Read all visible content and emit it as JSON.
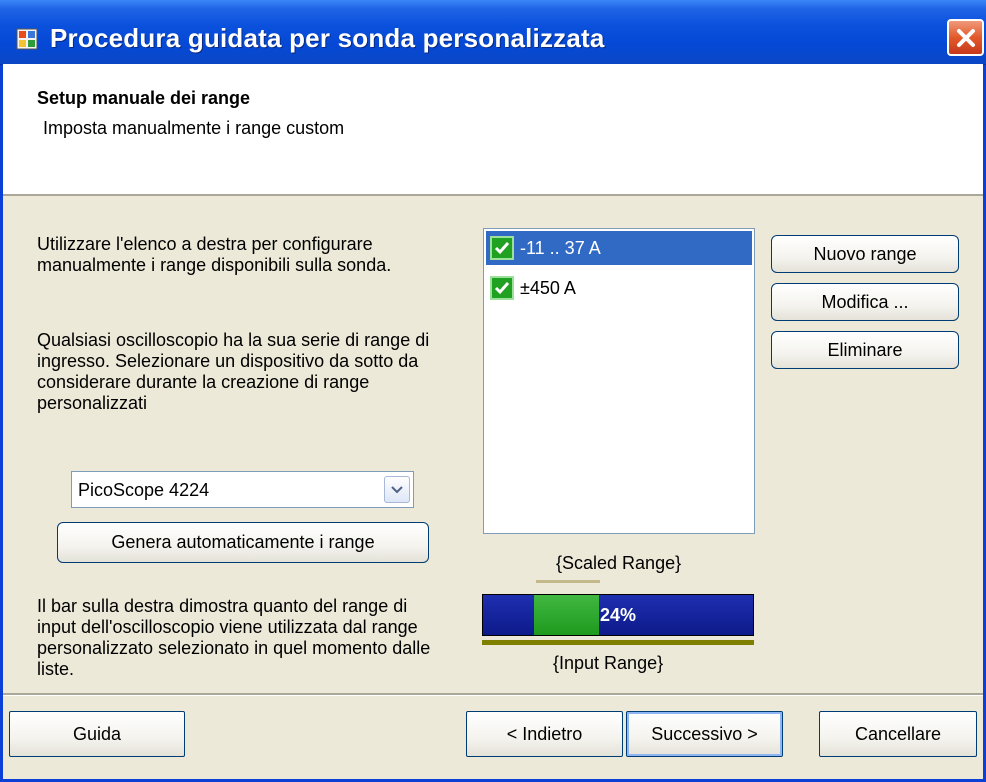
{
  "window": {
    "title": "Procedura guidata per sonda personalizzata"
  },
  "header": {
    "title": "Setup manuale dei range",
    "subtitle": "Imposta manualmente i range custom"
  },
  "instructions": {
    "para1": "Utilizzare l'elenco a destra per configurare manualmente i range disponibili sulla sonda.",
    "para2": "Qualsiasi oscilloscopio ha la sua serie di range di ingresso. Selezionare un dispositivo da sotto da considerare durante la creazione di range personalizzati",
    "para3": "Il bar sulla destra dimostra quanto del range di input dell'oscilloscopio viene utilizzata dal range personalizzato selezionato in quel momento dalle liste."
  },
  "device_select": {
    "value": "PicoScope 4224"
  },
  "buttons": {
    "auto_generate": "Genera automaticamente i range",
    "new_range": "Nuovo range",
    "edit": "Modifica ...",
    "delete": "Eliminare"
  },
  "ranges": [
    {
      "label": "-11 .. 37 A",
      "checked": true,
      "selected": true
    },
    {
      "label": "±450 A",
      "checked": true,
      "selected": false
    }
  ],
  "range_bar": {
    "scaled_label": "{Scaled Range}",
    "input_label": "{Input Range}",
    "percent_text": "24%",
    "fill_start_fraction": 0.19,
    "fill_end_fraction": 0.43,
    "colors": {
      "background": "#0d1a8a",
      "fill": "#2ea82e",
      "input_line": "#808000",
      "scaled_line": "#c4b98b"
    }
  },
  "footer": {
    "help": "Guida",
    "back": "< Indietro",
    "next": "Successivo >",
    "cancel": "Cancellare"
  },
  "icons": {
    "app": "app-window-icon",
    "close": "close-icon",
    "dropdown": "chevron-down-icon",
    "check": "checkbox-checked-icon"
  }
}
